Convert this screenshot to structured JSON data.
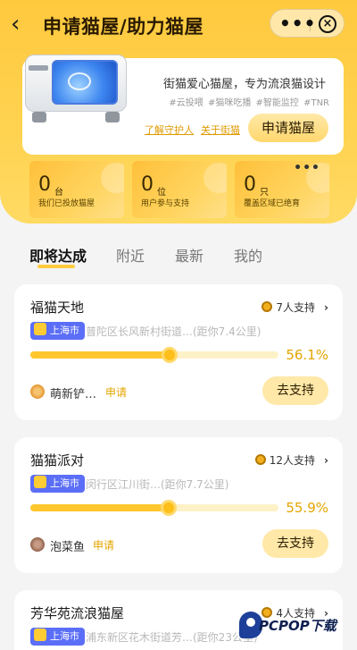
{
  "nav": {
    "back_icon": "chevron-left-icon",
    "title": "申请猫屋/助力猫屋",
    "more_icon": "more-dots-icon",
    "close_icon": "close-circle-icon"
  },
  "hero": {
    "slogan": "街猫爱心猫屋，专为流浪猫设计",
    "tags": "#云投喂 #猫咪吃播 #智能监控 #TNR",
    "link_guardian": "了解守护人",
    "link_about": "关于街猫",
    "apply_button": "申请猫屋"
  },
  "stats": [
    {
      "num": "0",
      "unit": "台",
      "desc": "我们已投放猫屋"
    },
    {
      "num": "0",
      "unit": "位",
      "desc": "用户参与支持"
    },
    {
      "num": "0",
      "unit": "只",
      "desc": "覆盖区域已绝育"
    }
  ],
  "tabs": [
    "即将达成",
    "附近",
    "最新",
    "我的"
  ],
  "active_tab": "即将达成",
  "cards": [
    {
      "name": "福猫天地",
      "support": "7人支持",
      "city": "上海市",
      "address": "普陀区长风新村街道…(距你7.4公里)",
      "progress": 0.561,
      "percent_text": "56.1%",
      "user": "萌新铲…",
      "tag": "申请",
      "button": "去支持"
    },
    {
      "name": "猫猫派对",
      "support": "12人支持",
      "city": "上海市",
      "address": "闵行区江川街…(距你7.7公里)",
      "progress": 0.559,
      "percent_text": "55.9%",
      "user": "泡菜鱼",
      "tag": "申请",
      "button": "去支持"
    },
    {
      "name": "芳华苑流浪猫屋",
      "support": "4人支持",
      "city": "上海市",
      "address": "浦东新区花木街道芳…(距你23公里)"
    }
  ],
  "watermark": "PCPOP下载",
  "colors": {
    "accent": "#ffc93e",
    "progress": "#ffc62e",
    "city_badge": "#5b6ef7",
    "percent": "#e4a500"
  }
}
